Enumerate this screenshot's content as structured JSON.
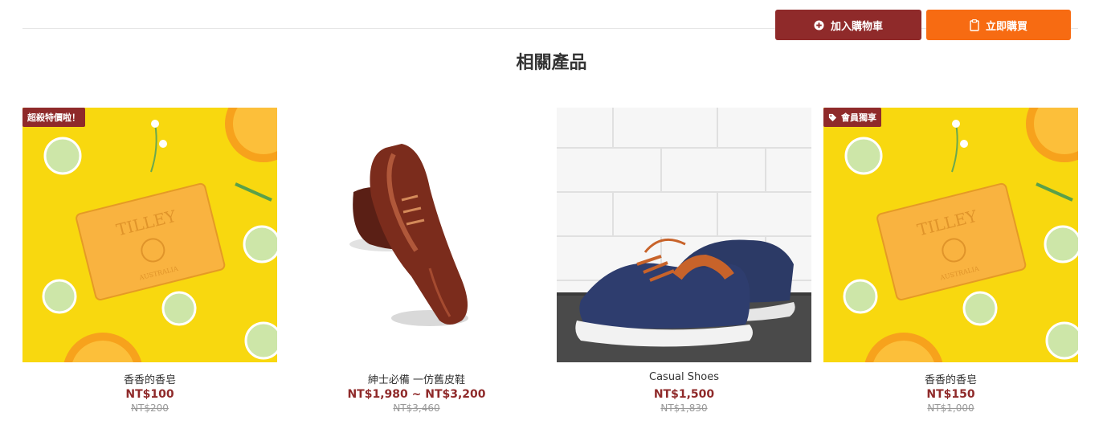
{
  "actions": {
    "add_to_cart": "加入購物車",
    "buy_now": "立即購買"
  },
  "section": {
    "title": "相關產品"
  },
  "colors": {
    "brand": "#8f2a2a",
    "buy_button": "#f76b12",
    "price": "#8f2a2a"
  },
  "products": [
    {
      "name": "香香的香皂",
      "price": "NT$100",
      "original_price": "NT$200",
      "badge": "超殺特價啦！",
      "badge_icon": "",
      "image": "soap-photo"
    },
    {
      "name": "紳士必備 一仿舊皮鞋",
      "price": "NT$1,980 ~ NT$3,200",
      "original_price": "NT$3,460",
      "badge": "",
      "badge_icon": "",
      "image": "leather-shoes-photo"
    },
    {
      "name": "Casual Shoes",
      "price": "NT$1,500",
      "original_price": "NT$1,830",
      "badge": "",
      "badge_icon": "",
      "image": "canvas-shoes-photo"
    },
    {
      "name": "香香的香皂",
      "price": "NT$150",
      "original_price": "NT$1,000",
      "badge": "會員獨享",
      "badge_icon": "tag-icon",
      "image": "soap-photo"
    }
  ]
}
